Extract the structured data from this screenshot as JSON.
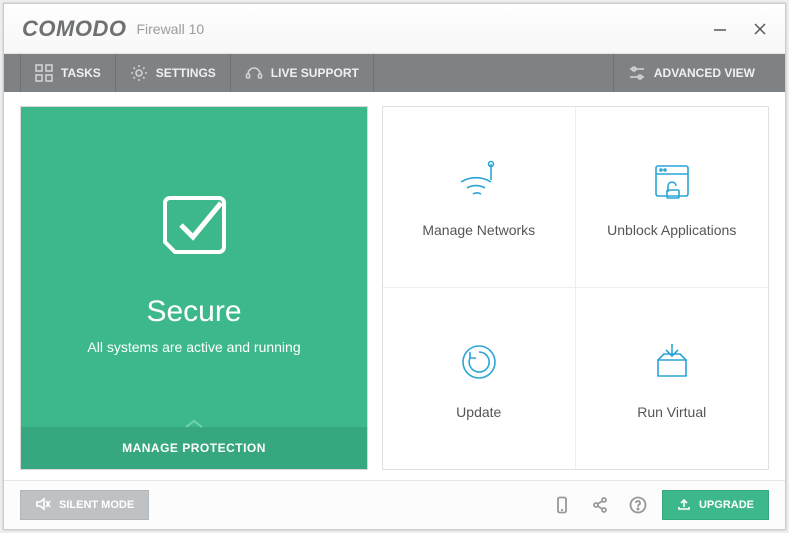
{
  "titlebar": {
    "logo": "COMODO",
    "product": "Firewall  10"
  },
  "toolbar": {
    "tasks": "TASKS",
    "settings": "SETTINGS",
    "live_support": "LIVE SUPPORT",
    "advanced_view": "ADVANCED VIEW"
  },
  "status": {
    "title": "Secure",
    "subtitle": "All systems are active and running",
    "manage": "MANAGE PROTECTION"
  },
  "tiles": {
    "manage_networks": "Manage Networks",
    "unblock_applications": "Unblock Applications",
    "update": "Update",
    "run_virtual": "Run Virtual"
  },
  "bottom": {
    "silent_mode": "SILENT MODE",
    "upgrade": "UPGRADE"
  }
}
